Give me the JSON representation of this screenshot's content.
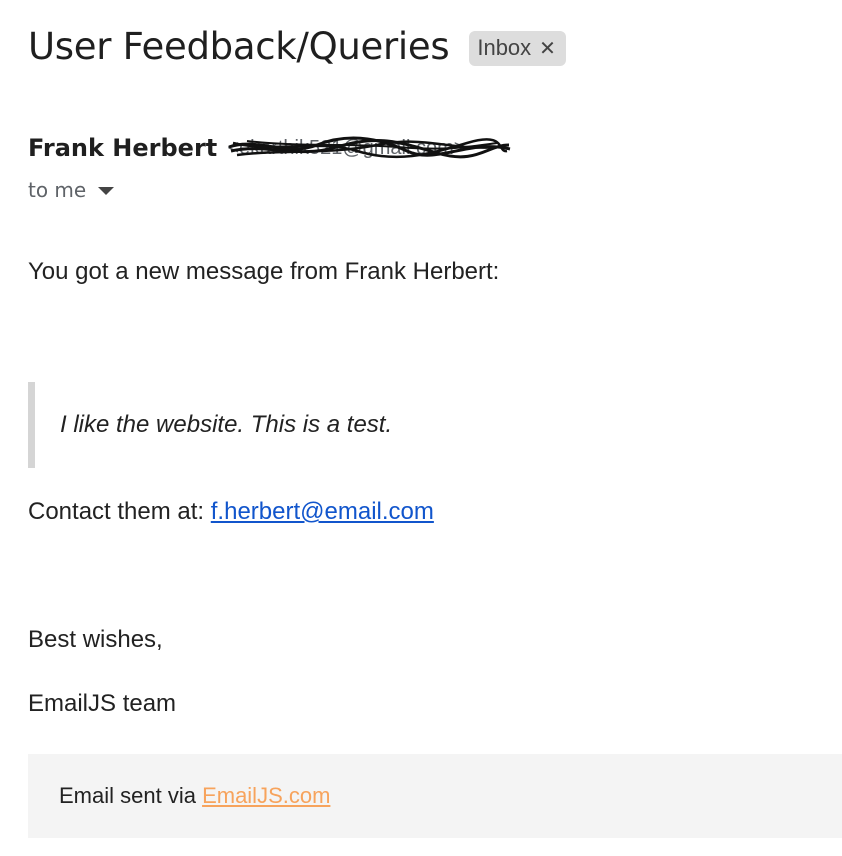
{
  "email": {
    "subject": "User Feedback/Queries",
    "label": "Inbox",
    "sender": {
      "name": "Frank Herbert",
      "address_redacted": "<ekarthik521@gmail.com>"
    },
    "recipient": "to me",
    "body": {
      "intro": "You got a new message from Frank Herbert:",
      "quote": "I like the website. This is a test.",
      "contact_prefix": "Contact them at: ",
      "contact_email": "f.herbert@email.com",
      "signoff": "Best wishes,",
      "team": "EmailJS team"
    },
    "footer": {
      "prefix": "Email sent via ",
      "link": "EmailJS.com"
    }
  },
  "icons": {
    "chip_close": "close-icon",
    "recipient_caret": "caret-down-icon"
  },
  "colors": {
    "link_blue": "#1155cc",
    "footer_link_orange": "#f7a35c",
    "chip_bg": "#dddddd",
    "footer_bg": "#f4f4f4",
    "quote_border": "#d5d5d5"
  }
}
